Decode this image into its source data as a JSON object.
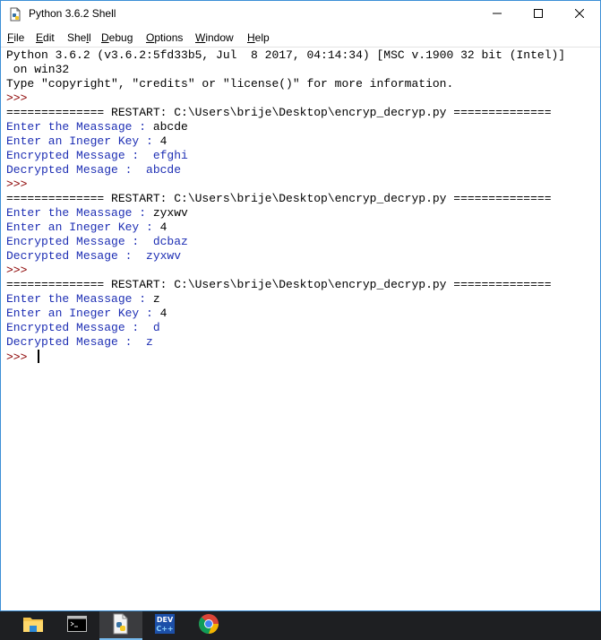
{
  "window": {
    "title": "Python 3.6.2 Shell",
    "controls": {
      "minimize": "minimize-icon",
      "maximize": "maximize-icon",
      "close": "close-icon"
    }
  },
  "menu": [
    {
      "label": "File",
      "mnemonic": "F",
      "rest": "ile"
    },
    {
      "label": "Edit",
      "mnemonic": "E",
      "rest": "dit"
    },
    {
      "label": "Shell",
      "pre": "She",
      "mnemonic": "l",
      "rest": "l"
    },
    {
      "label": "Debug",
      "mnemonic": "D",
      "rest": "ebug"
    },
    {
      "label": "Options",
      "mnemonic": "O",
      "rest": "ptions"
    },
    {
      "label": "Window",
      "mnemonic": "W",
      "rest": "indow"
    },
    {
      "label": "Help",
      "mnemonic": "H",
      "rest": "elp"
    }
  ],
  "shell": {
    "lines": [
      {
        "type": "output",
        "text": "Python 3.6.2 (v3.6.2:5fd33b5, Jul  8 2017, 04:14:34) [MSC v.1900 32 bit (Intel)]"
      },
      {
        "type": "output",
        "text": " on win32"
      },
      {
        "type": "output",
        "text": "Type \"copyright\", \"credits\" or \"license()\" for more information."
      },
      {
        "type": "prompt",
        "text": ">>> "
      },
      {
        "type": "output",
        "text": "============== RESTART: C:\\Users\\brije\\Desktop\\encryp_decryp.py =============="
      },
      {
        "type": "input",
        "label": "Enter the Meassage : ",
        "value": "abcde"
      },
      {
        "type": "input",
        "label": "Enter an Ineger Key : ",
        "value": "4"
      },
      {
        "type": "stdout",
        "text": "Encrypted Message :  efghi"
      },
      {
        "type": "stdout",
        "text": "Decrypted Mesage :  abcde"
      },
      {
        "type": "prompt",
        "text": ">>> "
      },
      {
        "type": "output",
        "text": "============== RESTART: C:\\Users\\brije\\Desktop\\encryp_decryp.py =============="
      },
      {
        "type": "input",
        "label": "Enter the Meassage : ",
        "value": "zyxwv"
      },
      {
        "type": "input",
        "label": "Enter an Ineger Key : ",
        "value": "4"
      },
      {
        "type": "stdout",
        "text": "Encrypted Message :  dcbaz"
      },
      {
        "type": "stdout",
        "text": "Decrypted Mesage :  zyxwv"
      },
      {
        "type": "prompt",
        "text": ">>> "
      },
      {
        "type": "output",
        "text": "============== RESTART: C:\\Users\\brije\\Desktop\\encryp_decryp.py =============="
      },
      {
        "type": "input",
        "label": "Enter the Meassage : ",
        "value": "z"
      },
      {
        "type": "input",
        "label": "Enter an Ineger Key : ",
        "value": "4"
      },
      {
        "type": "stdout",
        "text": "Encrypted Message :  d"
      },
      {
        "type": "stdout",
        "text": "Decrypted Mesage :  z"
      },
      {
        "type": "prompt-cursor",
        "text": ">>> "
      }
    ]
  },
  "taskbar": {
    "items": [
      {
        "name": "file-explorer-icon",
        "active": false
      },
      {
        "name": "command-prompt-icon",
        "active": false
      },
      {
        "name": "python-idle-icon",
        "active": true
      },
      {
        "name": "dev-cpp-icon",
        "active": false
      },
      {
        "name": "chrome-icon",
        "active": false
      }
    ]
  },
  "colors": {
    "prompt": "#8b0000",
    "stdout": "#1e2fb4",
    "taskbar": "#1e1f22",
    "accent": "#76b9ed"
  }
}
